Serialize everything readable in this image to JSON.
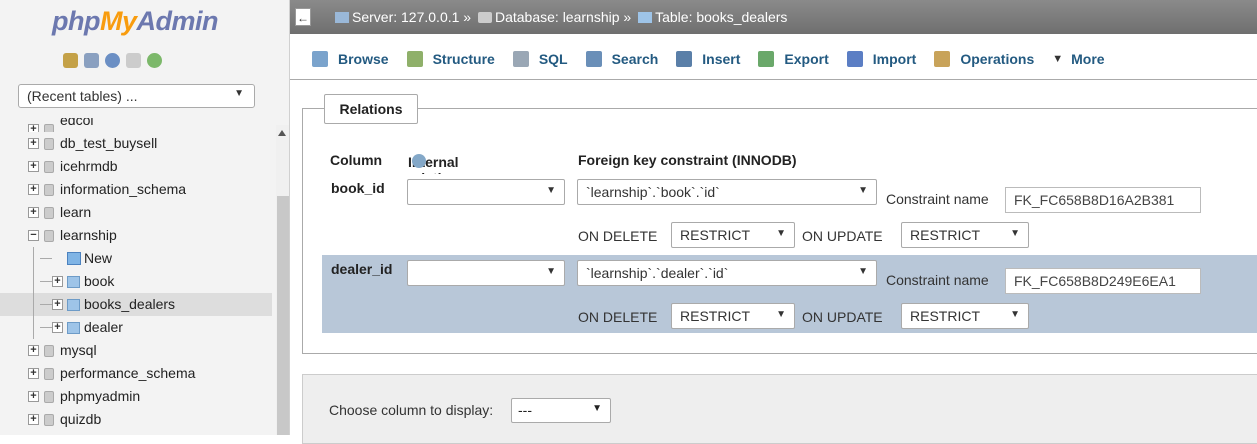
{
  "nav": {
    "logo": {
      "php": "php",
      "my": "My",
      "admin": "Admin"
    },
    "recent_tables": "(Recent tables) ...",
    "databases": [
      {
        "label": "edcol",
        "expanded": false
      },
      {
        "label": "db_test_buysell",
        "expanded": false
      },
      {
        "label": "icehrmdb",
        "expanded": false
      },
      {
        "label": "information_schema",
        "expanded": false
      },
      {
        "label": "learn",
        "expanded": false
      },
      {
        "label": "learnship",
        "expanded": true
      },
      {
        "label": "New",
        "child": true
      },
      {
        "label": "book",
        "child": true
      },
      {
        "label": "books_dealers",
        "child": true,
        "selected": true
      },
      {
        "label": "dealer",
        "child": true
      },
      {
        "label": "mysql",
        "expanded": false
      },
      {
        "label": "performance_schema",
        "expanded": false
      },
      {
        "label": "phpmyadmin",
        "expanded": false
      },
      {
        "label": "quizdb",
        "expanded": false
      }
    ]
  },
  "breadcrumb": {
    "server": "Server: 127.0.0.1",
    "sep1": "»",
    "database": "Database: learnship",
    "sep2": "»",
    "table": "Table: books_dealers"
  },
  "tabs": [
    {
      "label": "Browse",
      "icon": "browse-icon",
      "color": "#7aa3cc"
    },
    {
      "label": "Structure",
      "icon": "structure-icon",
      "color": "#8fb06a"
    },
    {
      "label": "SQL",
      "icon": "sql-icon",
      "color": "#9aa7b5"
    },
    {
      "label": "Search",
      "icon": "search-icon",
      "color": "#6a8fb8"
    },
    {
      "label": "Insert",
      "icon": "insert-icon",
      "color": "#5a7fa8"
    },
    {
      "label": "Export",
      "icon": "export-icon",
      "color": "#6aa86a"
    },
    {
      "label": "Import",
      "icon": "import-icon",
      "color": "#5b7ec4"
    },
    {
      "label": "Operations",
      "icon": "wrench-icon",
      "color": "#c8a35a"
    },
    {
      "label": "More",
      "icon": "caret-down-icon",
      "color": "#333333"
    }
  ],
  "relations": {
    "legend": "Relations",
    "headers": {
      "column": "Column",
      "internal": "Internal relation",
      "foreign": "Foreign key constraint (INNODB)"
    },
    "rows": [
      {
        "column": "book_id",
        "internal_value": "",
        "fk_value": "`learnship`.`book`.`id`",
        "constraint_label": "Constraint name",
        "constraint_name": "FK_FC658B8D16A2B381",
        "on_delete_label": "ON DELETE",
        "on_delete": "RESTRICT",
        "on_update_label": "ON UPDATE",
        "on_update": "RESTRICT",
        "highlight": false
      },
      {
        "column": "dealer_id",
        "internal_value": "",
        "fk_value": "`learnship`.`dealer`.`id`",
        "constraint_label": "Constraint name",
        "constraint_name": "FK_FC658B8D249E6EA1",
        "on_delete_label": "ON DELETE",
        "on_delete": "RESTRICT",
        "on_update_label": "ON UPDATE",
        "on_update": "RESTRICT",
        "highlight": true
      }
    ]
  },
  "display": {
    "label": "Choose column to display:",
    "value": "---"
  },
  "colors": {
    "row_highlight": "#b8c7d8",
    "link_blue": "#235a81"
  }
}
